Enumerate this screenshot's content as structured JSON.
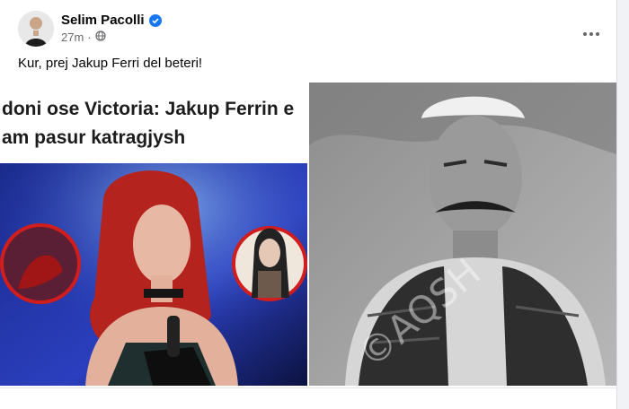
{
  "post": {
    "author": "Selim Pacolli",
    "time": "27m",
    "text": "Kur, prej Jakup Ferri del beteri!"
  },
  "article": {
    "headline_line1": "doni ose Victoria: Jakup Ferrin e",
    "headline_line2": "am pasur katragjysh"
  },
  "photo": {
    "watermark": "©AQSH"
  },
  "colors": {
    "verified": "#1877f2",
    "text_primary": "#050505",
    "text_secondary": "#65676b"
  },
  "icons": {
    "verified": "verified-badge-icon",
    "privacy": "globe-icon",
    "more": "more-options-icon"
  }
}
